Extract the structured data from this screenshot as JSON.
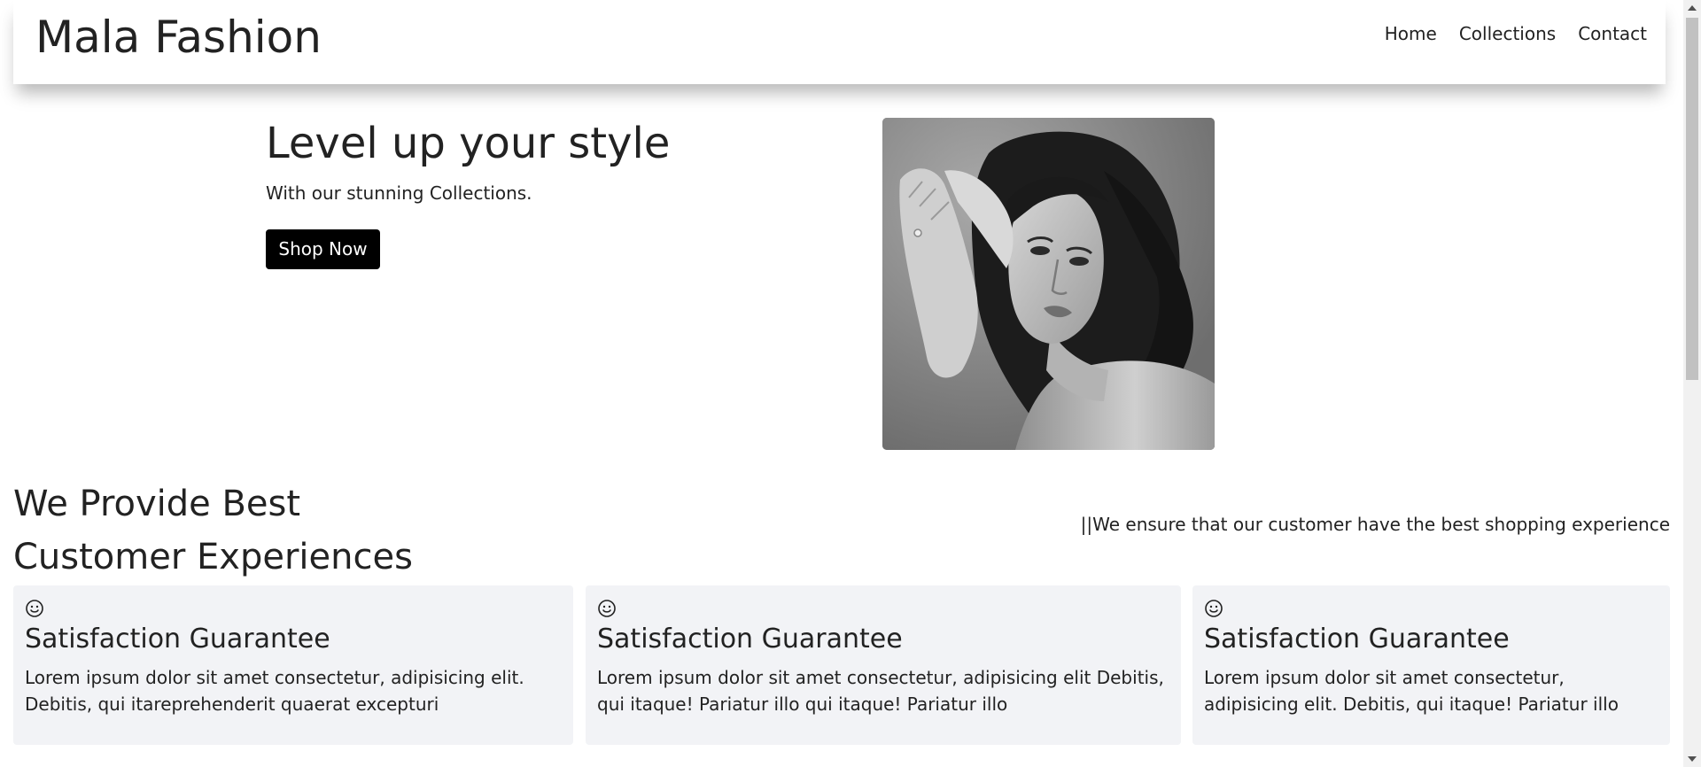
{
  "navbar": {
    "brand": "Mala Fashion",
    "links": [
      "Home",
      "Collections",
      "Contact"
    ]
  },
  "hero": {
    "title": "Level up your style",
    "subtitle": "With our stunning Collections.",
    "button_label": "Shop Now",
    "image_icon": "fashion-model-portrait"
  },
  "experience": {
    "title_line1": "We Provide Best",
    "title_line2": "Customer Experiences",
    "tagline": "||We ensure that our customer have the best shopping experience",
    "cards": [
      {
        "icon": "smiley-icon",
        "title": "Satisfaction Guarantee",
        "text": "Lorem ipsum dolor sit amet consectetur, adipisicing elit. Debitis, qui itareprehenderit quaerat excepturi"
      },
      {
        "icon": "smiley-icon",
        "title": "Satisfaction Guarantee",
        "text": "Lorem ipsum dolor sit amet consectetur, adipisicing elit Debitis, qui itaque! Pariatur illo qui itaque! Pariatur illo"
      },
      {
        "icon": "smiley-icon",
        "title": "Satisfaction Guarantee",
        "text": "Lorem ipsum dolor sit amet consectetur, adipisicing elit. Debitis, qui itaque! Pariatur illo"
      }
    ]
  },
  "colors": {
    "button_bg": "#000000",
    "card_bg": "#f2f3f6",
    "text": "#222222"
  }
}
